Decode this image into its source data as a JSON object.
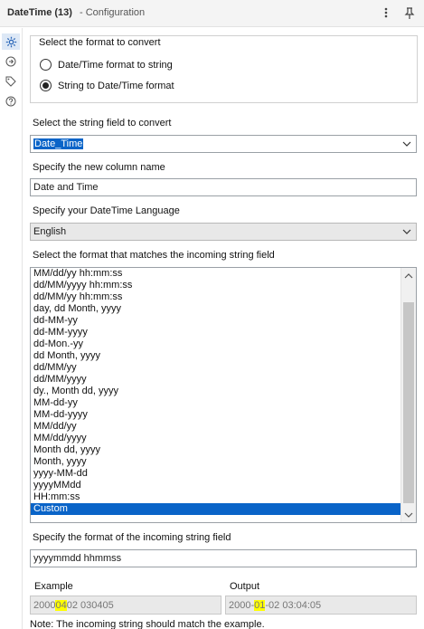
{
  "header": {
    "title": "DateTime (13)",
    "subtitle": "- Configuration"
  },
  "conversion_group": {
    "legend": "Select the format to convert",
    "options": [
      {
        "label": "Date/Time format to string",
        "checked": false
      },
      {
        "label": "String to Date/Time format",
        "checked": true
      }
    ]
  },
  "string_field": {
    "label": "Select the string field to convert",
    "value": "Date_Time"
  },
  "new_column": {
    "label": "Specify the new column name",
    "value": "Date and Time"
  },
  "language": {
    "label": "Specify your DateTime Language",
    "value": "English"
  },
  "formats": {
    "label": "Select the format that matches the incoming string field",
    "items": [
      "MM/dd/yy hh:mm:ss",
      "dd/MM/yyyy hh:mm:ss",
      "dd/MM/yy hh:mm:ss",
      "day, dd Month, yyyy",
      "dd-MM-yy",
      "dd-MM-yyyy",
      "dd-Mon.-yy",
      "dd Month, yyyy",
      "dd/MM/yy",
      "dd/MM/yyyy",
      "dy., Month dd, yyyy",
      "MM-dd-yy",
      "MM-dd-yyyy",
      "MM/dd/yy",
      "MM/dd/yyyy",
      "Month dd, yyyy",
      "Month, yyyy",
      "yyyy-MM-dd",
      "yyyyMMdd",
      "HH:mm:ss",
      "Custom"
    ],
    "selected": "Custom"
  },
  "custom_format": {
    "label": "Specify the format of the incoming string field",
    "value": "yyyymmdd hhmmss"
  },
  "example": {
    "label": "Example",
    "before": "2000",
    "highlight": "04",
    "after": "02 030405"
  },
  "output": {
    "label": "Output",
    "before": "2000-",
    "highlight": "01",
    "after": "-02 03:04:05"
  },
  "note": "Note: The incoming string should match the example."
}
